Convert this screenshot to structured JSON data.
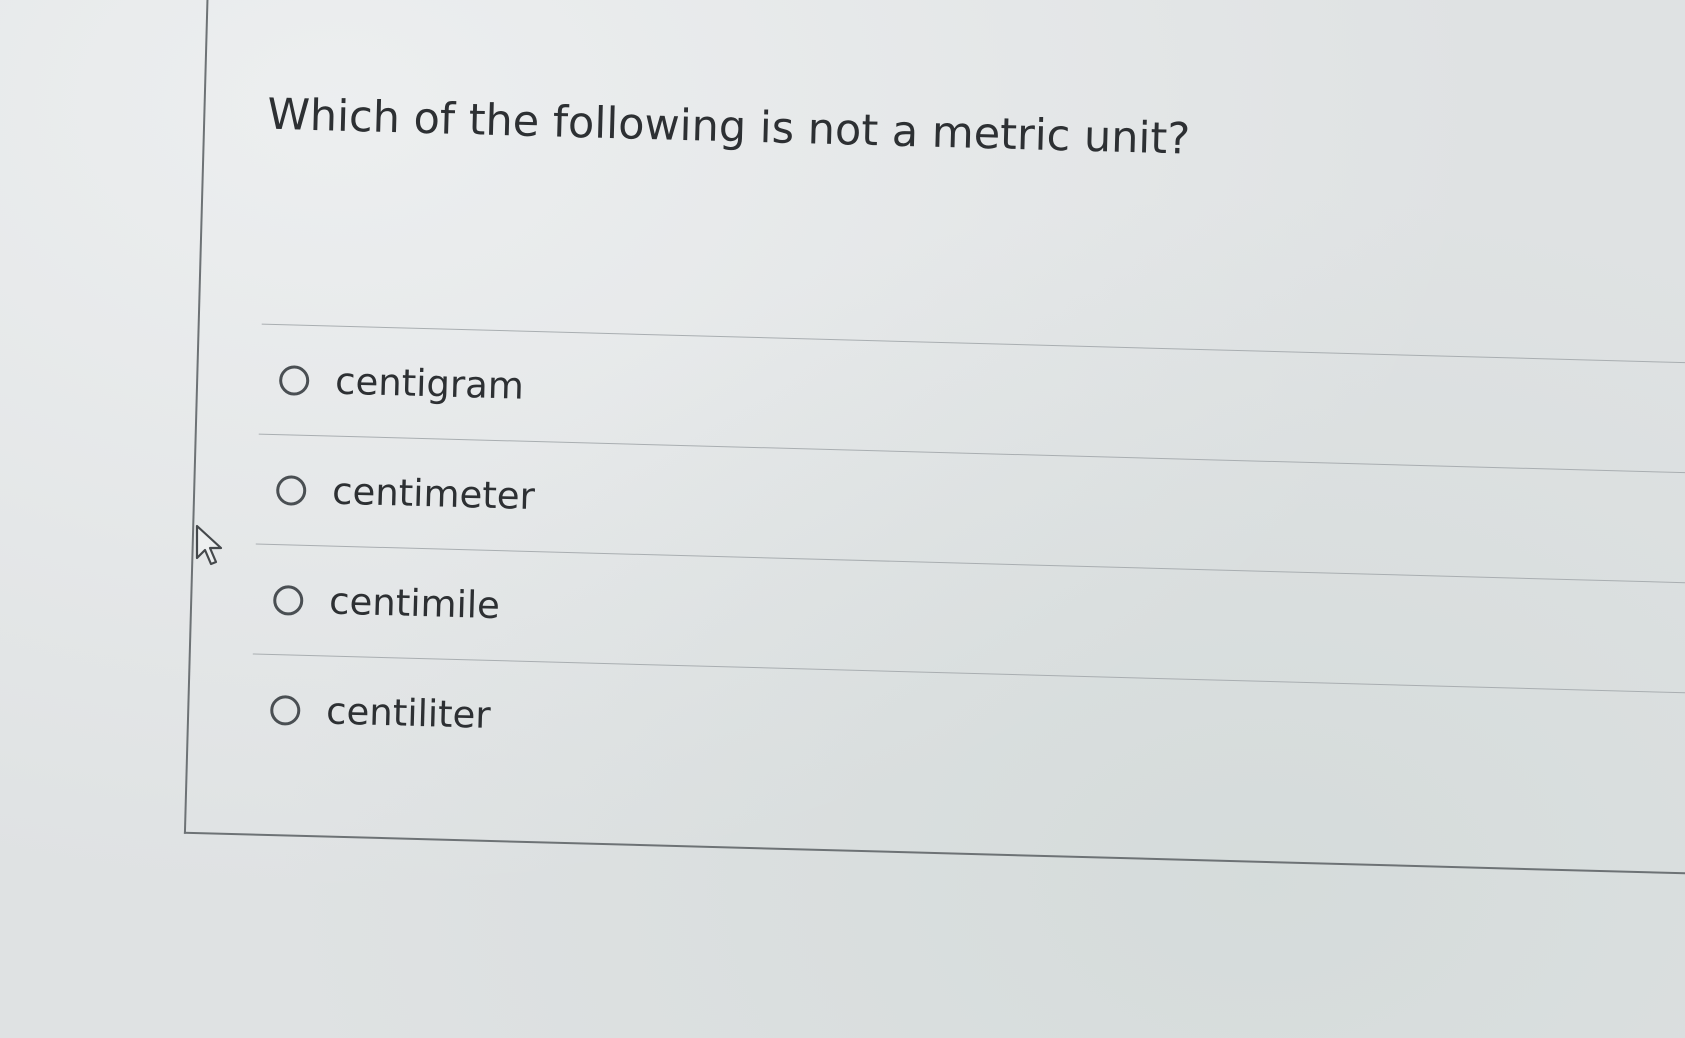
{
  "question": {
    "text": "Which of the following is not a metric unit?"
  },
  "answers": [
    {
      "label": "centigram",
      "selected": false
    },
    {
      "label": "centimeter",
      "selected": false
    },
    {
      "label": "centimile",
      "selected": false
    },
    {
      "label": "centiliter",
      "selected": false
    }
  ],
  "colors": {
    "background": "#dfe2e3",
    "text": "#2d3033",
    "border": "#6d7275",
    "divider": "#a9aeb1"
  },
  "icons": {
    "cursor": "mouse-pointer-icon",
    "radio": "radio-button-icon"
  }
}
